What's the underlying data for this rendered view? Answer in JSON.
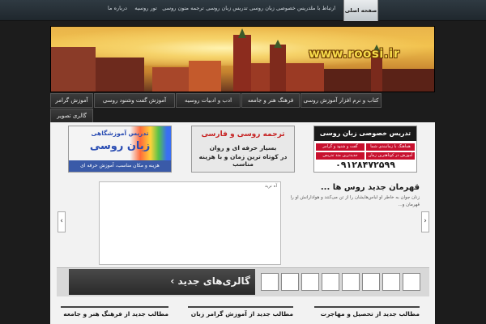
{
  "topnav": {
    "active": "صفحه اصلی",
    "items": [
      "ارتباط با ما",
      "تدریس خصوصی زبان روسی",
      "تدریس زبان روسی",
      "ترجمه متون روسی",
      "تور روسیه",
      "درباره ما"
    ]
  },
  "banner": {
    "url_text": "www.roosi.ir"
  },
  "categories": [
    "آموزش گرامر",
    "آموزش گفت وشنود روسی",
    "ادب و ادبیات روسیه",
    "فرهنگ هنر و جامعه",
    "کتاب و نرم افزار آموزش روسی",
    "گالری تصویر"
  ],
  "ads": {
    "school": {
      "line1": "تدریس آموزشگاهی",
      "line2": "زبان روسی",
      "line3": "هزینه و مکان مناسب، آموزش حرفه ای"
    },
    "translation": {
      "line1": "ترجمه روسی و فارسی",
      "line2": "بسیار حرفه ای و روان",
      "line3": "در کوتاه ترین زمان",
      "line4": "و با هزینه مناسب"
    },
    "private": {
      "head": "تدریس خصوصی زبان روسی",
      "rows": [
        "هماهنگ با زمانبندی شما",
        "گفت و شنود و گرامر",
        "آموزش در کوتاهترین زمان",
        "جدیدترین متد تدریس"
      ],
      "phone": "۰۹۱۲۸۴۷۲۵۹۹"
    }
  },
  "slider": {
    "caption": "آه نرید",
    "prev": "‹",
    "next": "›"
  },
  "news": {
    "title": "قهرمان جدید روس ها ...",
    "text": "زنان جوان به خاطر او لباس‌هایشان را از تن می‌کنند و هوادارانش او را قهرمان و..."
  },
  "gallery": {
    "label": "گالری‌های جدید",
    "chevron": "›"
  },
  "footer": {
    "col1": "مطالب جدید از تحصیل و مهاجرت",
    "col2": "مطالب جدید از آموزش گرامر زبان",
    "col3": "مطالب جدید از فرهنگ هنر و جامعه"
  }
}
